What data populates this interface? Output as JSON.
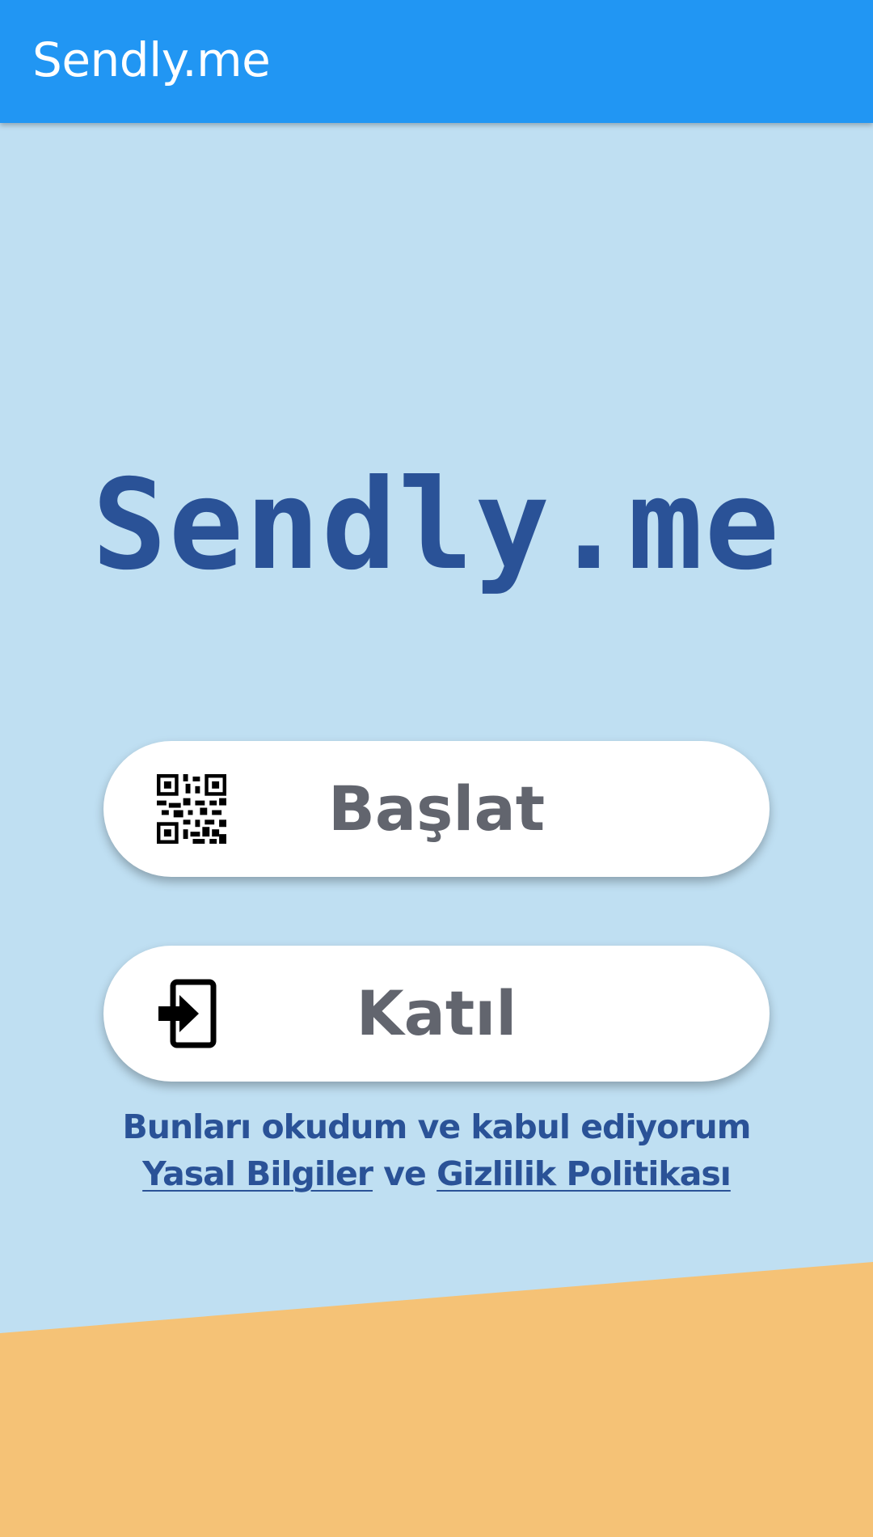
{
  "app_bar": {
    "title": "Sendly.me"
  },
  "logo": {
    "text": "Sendly.me"
  },
  "buttons": {
    "start": {
      "label": "Başlat",
      "icon": "qr-code-icon"
    },
    "join": {
      "label": "Katıl",
      "icon": "login-icon"
    }
  },
  "terms": {
    "line1": "Bunları okudum ve kabul ediyorum",
    "legal_link": "Yasal Bilgiler",
    "connector": "ve",
    "privacy_link": "Gizlilik Politikası"
  },
  "colors": {
    "app_bar": "#2196f3",
    "background": "#bfdff2",
    "accent_text": "#2a5297",
    "bottom_band": "#f5c276",
    "button_text": "#62656e"
  }
}
